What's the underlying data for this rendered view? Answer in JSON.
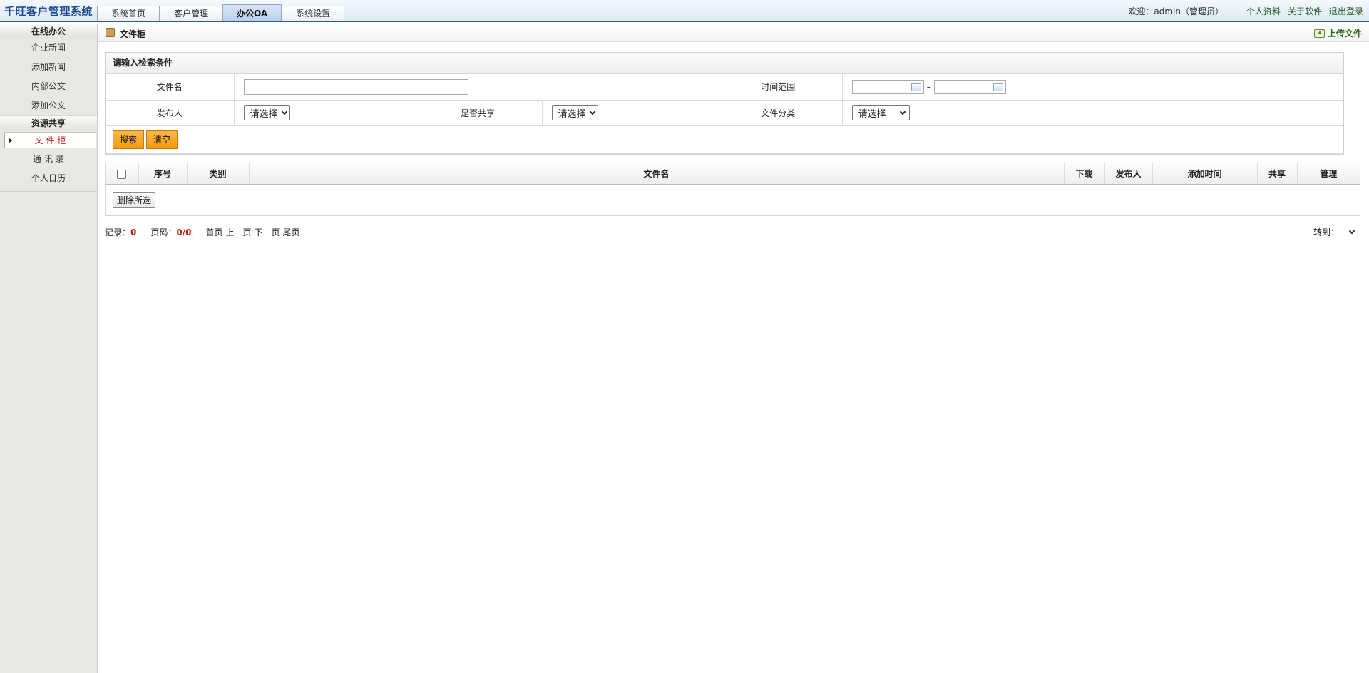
{
  "header": {
    "logo": "千旺客户管理系统",
    "tabs": [
      {
        "label": "系统首页",
        "active": false
      },
      {
        "label": "客户管理",
        "active": false
      },
      {
        "label": "办公OA",
        "active": true
      },
      {
        "label": "系统设置",
        "active": false
      }
    ],
    "welcome": "欢迎：admin（管理员）",
    "links": [
      "个人资料",
      "关于软件",
      "退出登录"
    ]
  },
  "sidebar": {
    "groups": [
      {
        "title": "在线办公",
        "items": [
          "企业新闻",
          "添加新闻",
          "内部公文",
          "添加公文"
        ]
      },
      {
        "title": "资源共享",
        "items": [
          "文 件 柜",
          "通 讯 录",
          "个人日历"
        ]
      }
    ],
    "active_item": "文 件 柜"
  },
  "page": {
    "title": "文件柜",
    "upload_label": "上传文件"
  },
  "search": {
    "heading": "请输入检索条件",
    "filename_label": "文件名",
    "filename_value": "",
    "time_range_label": "时间范围",
    "time_start": "",
    "time_end": "",
    "dash": "–",
    "publisher_label": "发布人",
    "publisher_value": "请选择",
    "shared_label": "是否共享",
    "shared_value": "请选择",
    "category_label": "文件分类",
    "category_value": "请选择",
    "search_button": "搜索",
    "clear_button": "清空"
  },
  "results": {
    "columns": [
      "序号",
      "类别",
      "文件名",
      "下载",
      "发布人",
      "添加时间",
      "共享",
      "管理"
    ],
    "rows": [],
    "delete_selected": "删除所选"
  },
  "pager": {
    "records_label": "记录：",
    "records_value": "0",
    "pages_label": "页码：",
    "pages_value": "0/0",
    "first": "首页",
    "prev": "上一页",
    "next": "下一页",
    "last": "尾页",
    "jump_label": "转到："
  },
  "colors": {
    "accent_blue": "#1f4c98",
    "orange_button": "#f59a14",
    "red_count": "#c21d1d"
  }
}
